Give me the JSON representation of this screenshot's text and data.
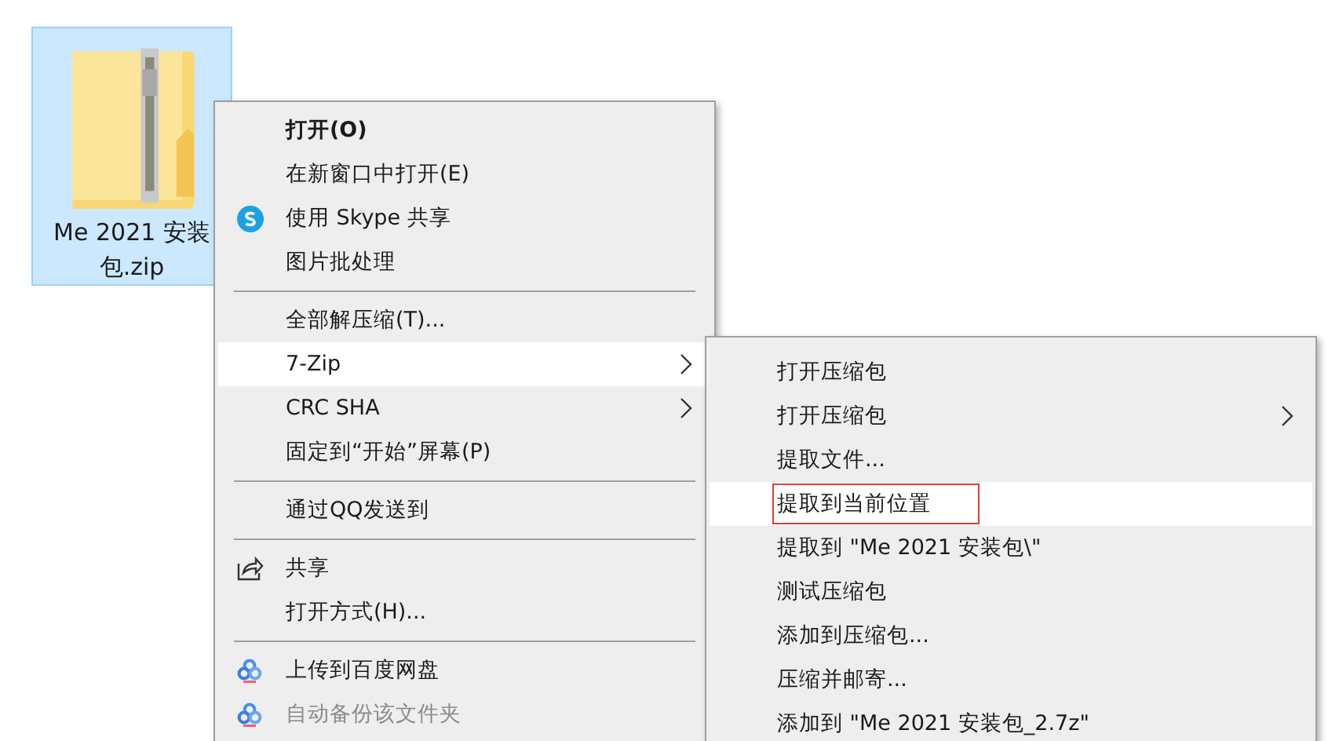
{
  "file": {
    "name": "Me 2021 安装包.zip",
    "selected": true
  },
  "context_menu": {
    "items": [
      {
        "kind": "item",
        "label": "打开(O)",
        "default": true,
        "selected": false,
        "disabled": false,
        "submenu": false
      },
      {
        "kind": "item",
        "label": "在新窗口中打开(E)",
        "default": false,
        "selected": false,
        "disabled": false,
        "submenu": false
      },
      {
        "kind": "skype-item",
        "label": "使用 Skype 共享",
        "default": false,
        "selected": false,
        "disabled": false,
        "submenu": false
      },
      {
        "kind": "item",
        "label": "图片批处理",
        "default": false,
        "selected": false,
        "disabled": false,
        "submenu": false
      },
      {
        "kind": "separator"
      },
      {
        "kind": "item",
        "label": "全部解压缩(T)...",
        "default": false,
        "selected": false,
        "disabled": false,
        "submenu": false
      },
      {
        "kind": "item",
        "label": "7-Zip",
        "default": false,
        "selected": true,
        "disabled": false,
        "submenu": true
      },
      {
        "kind": "item",
        "label": "CRC SHA",
        "default": false,
        "selected": false,
        "disabled": false,
        "submenu": true
      },
      {
        "kind": "item",
        "label": "固定到“开始”屏幕(P)",
        "default": false,
        "selected": false,
        "disabled": false,
        "submenu": false
      },
      {
        "kind": "separator"
      },
      {
        "kind": "item",
        "label": "通过QQ发送到",
        "default": false,
        "selected": false,
        "disabled": false,
        "submenu": false
      },
      {
        "kind": "separator"
      },
      {
        "kind": "share-item",
        "label": "共享",
        "default": false,
        "selected": false,
        "disabled": false,
        "submenu": false
      },
      {
        "kind": "item",
        "label": "打开方式(H)...",
        "default": false,
        "selected": false,
        "disabled": false,
        "submenu": false
      },
      {
        "kind": "separator"
      },
      {
        "kind": "cloud-item",
        "label": "上传到百度网盘",
        "default": false,
        "selected": false,
        "disabled": false,
        "submenu": false
      },
      {
        "kind": "cloud-item",
        "label": "自动备份该文件夹",
        "default": false,
        "selected": false,
        "disabled": true,
        "submenu": false
      }
    ]
  },
  "submenu": {
    "items": [
      {
        "label": "打开压缩包",
        "selected": false,
        "submenu": false,
        "annotated": false
      },
      {
        "label": "打开压缩包",
        "selected": false,
        "submenu": true,
        "annotated": false
      },
      {
        "label": "提取文件...",
        "selected": false,
        "submenu": false,
        "annotated": false
      },
      {
        "label": "提取到当前位置",
        "selected": true,
        "submenu": false,
        "annotated": true
      },
      {
        "label": "提取到 \"Me 2021 安装包\\\"",
        "selected": false,
        "submenu": false,
        "annotated": false
      },
      {
        "label": "测试压缩包",
        "selected": false,
        "submenu": false,
        "annotated": false
      },
      {
        "label": "添加到压缩包...",
        "selected": false,
        "submenu": false,
        "annotated": false
      },
      {
        "label": "压缩并邮寄...",
        "selected": false,
        "submenu": false,
        "annotated": false
      },
      {
        "label": "添加到 \"Me 2021 安装包_2.7z\"",
        "selected": false,
        "submenu": false,
        "annotated": false
      }
    ]
  }
}
